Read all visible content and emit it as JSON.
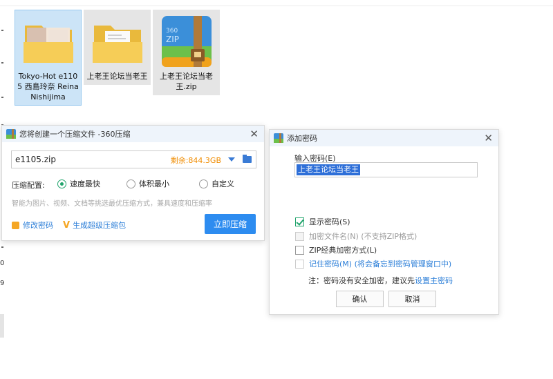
{
  "files": [
    {
      "name": "Tokyo-Hot e1105 西島玲奈 Reina Nishijima",
      "thumb": "photo-folder-icon"
    },
    {
      "name": "上老王论坛当老王",
      "thumb": "folder-icon"
    },
    {
      "name": "上老王论坛当老王.zip",
      "thumb": "zip-archive-icon",
      "zip_text": "360 ZIP"
    }
  ],
  "compress_dialog": {
    "title": "您将创建一个压缩文件 -360压缩",
    "filename": "e1105.zip",
    "free_space": "剩余:844.3GB",
    "config_label": "压缩配置:",
    "options": [
      "速度最快",
      "体积最小",
      "自定义"
    ],
    "selected_option": "速度最快",
    "hint": "智能为图片、视频、文档等挑选最优压缩方式，兼具速度和压缩率",
    "change_password": "修改密码",
    "make_super": "生成超级压缩包",
    "compress_now": "立即压缩"
  },
  "password_dialog": {
    "title": "添加密码",
    "input_label": "输入密码(E)",
    "password_value": "上老王论坛当老王",
    "show_password": "显示密码(S)",
    "encrypt_filenames": "加密文件名(N) (不支持ZIP格式)",
    "zip_classic": "ZIP经典加密方式(L)",
    "remember": "记住密码(M) (将会备忘到密码管理窗口中)",
    "note_prefix": "注：密码没有安全加密，建议先",
    "note_link": "设置主密码",
    "ok": "确认",
    "cancel": "取消"
  },
  "edge": {
    "glyph_a": "0",
    "glyph_b": "9"
  },
  "colors": {
    "accent": "#2d8cf0",
    "green": "#1fa36b",
    "orange": "#f08c00"
  }
}
